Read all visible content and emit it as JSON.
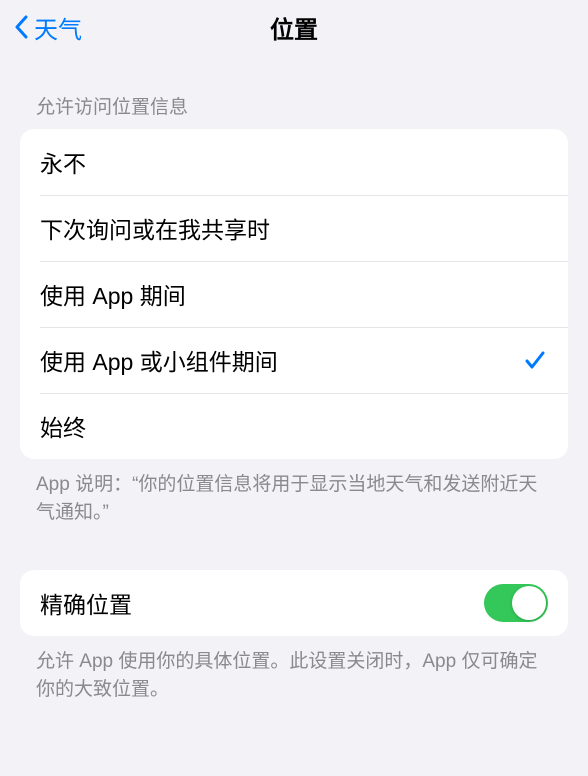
{
  "header": {
    "back_label": "天气",
    "title": "位置"
  },
  "section1": {
    "header": "允许访问位置信息",
    "options": [
      {
        "label": "永不",
        "selected": false
      },
      {
        "label": "下次询问或在我共享时",
        "selected": false
      },
      {
        "label": "使用 App 期间",
        "selected": false
      },
      {
        "label": "使用 App 或小组件期间",
        "selected": true
      },
      {
        "label": "始终",
        "selected": false
      }
    ],
    "footer": "App 说明：“你的位置信息将用于显示当地天气和发送附近天气通知。”"
  },
  "section2": {
    "precise_label": "精确位置",
    "precise_enabled": true,
    "footer": "允许 App 使用你的具体位置。此设置关闭时，App 仅可确定你的大致位置。"
  }
}
